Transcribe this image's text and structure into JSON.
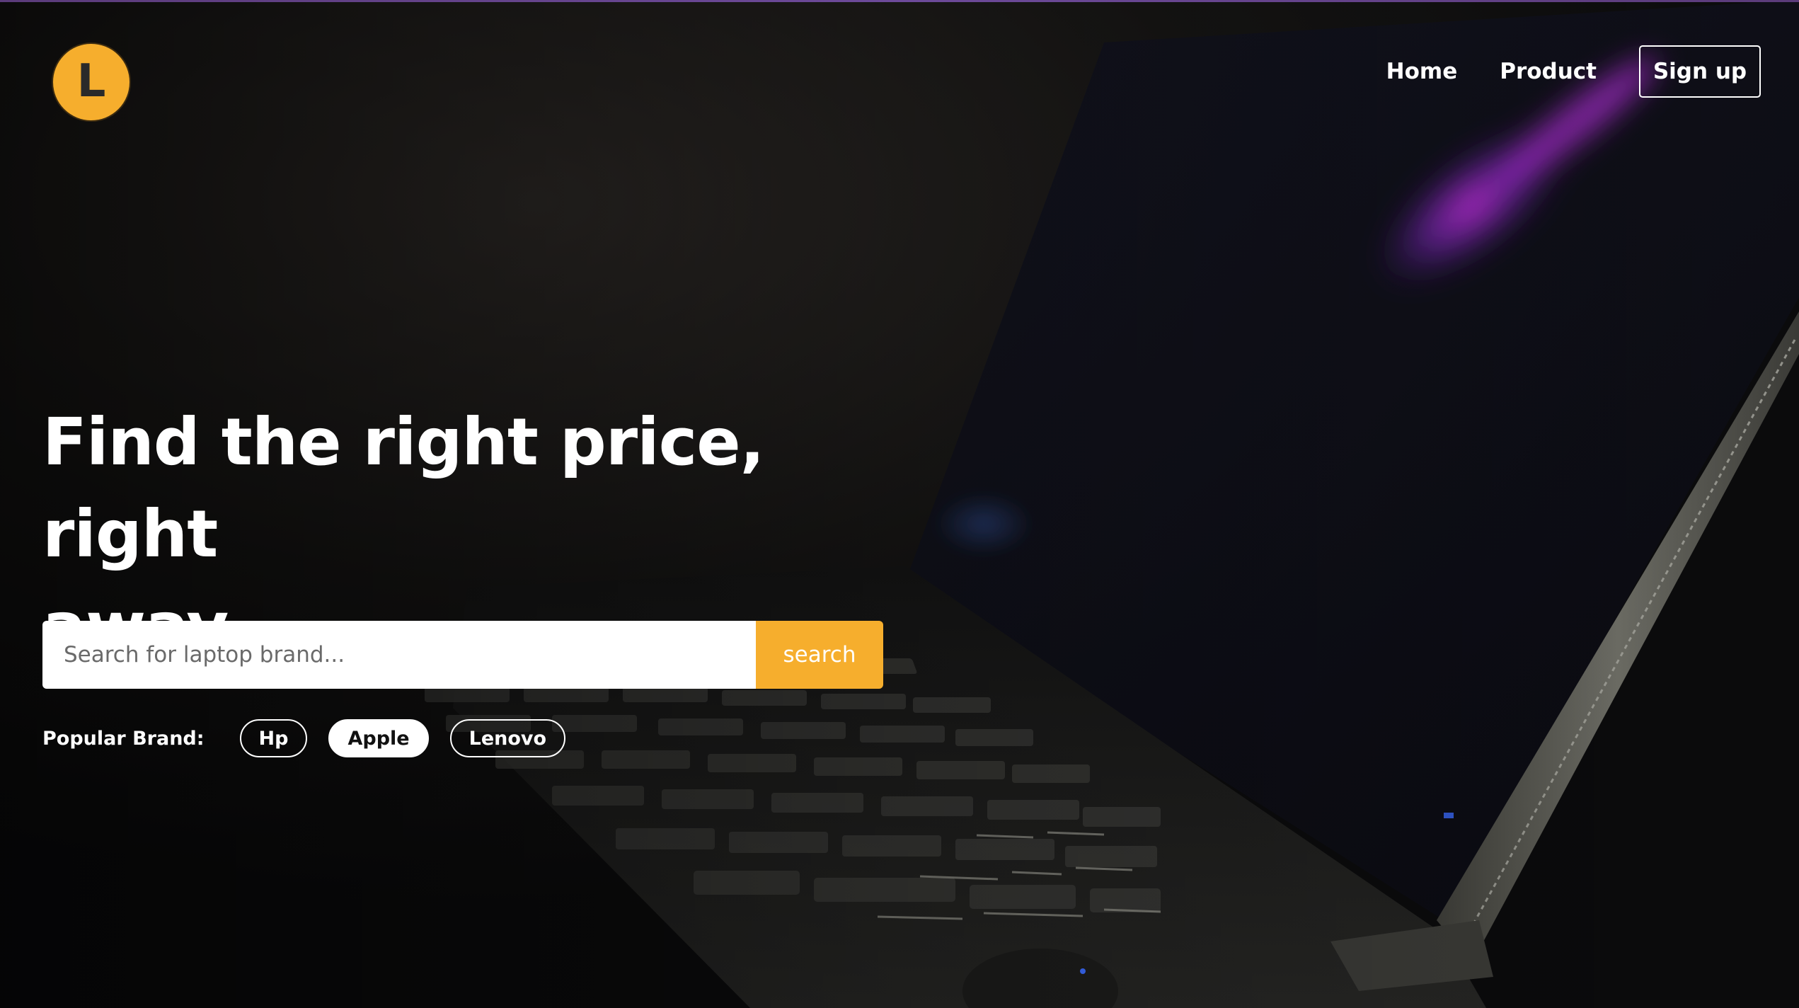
{
  "header": {
    "logo_letter": "L",
    "nav": {
      "home": "Home",
      "product": "Product",
      "signup": "Sign up"
    }
  },
  "hero": {
    "headline_line1": "Find the right price, right",
    "headline_line2": "away",
    "search": {
      "placeholder": "Search for laptop brand...",
      "value": "",
      "button_label": "search"
    },
    "popular": {
      "label": "Popular Brand:",
      "brands": [
        {
          "label": "Hp",
          "selected": false
        },
        {
          "label": "Apple",
          "selected": true
        },
        {
          "label": "Lenovo",
          "selected": false
        }
      ]
    }
  },
  "colors": {
    "accent": "#f6ae2d",
    "background": "#0d0d0e",
    "text": "#ffffff",
    "glow": "#c42bd6"
  },
  "icons": {
    "logo": "letter-L-circle-logo"
  }
}
